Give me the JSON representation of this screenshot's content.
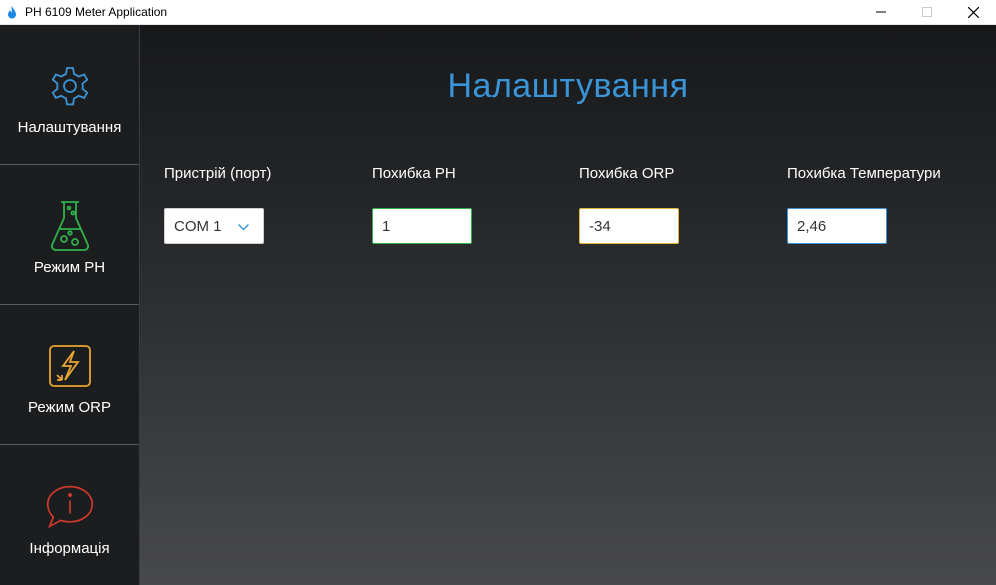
{
  "window": {
    "title": "PH 6109 Meter Application"
  },
  "sidebar": {
    "items": [
      {
        "label": "Налаштування",
        "icon": "gear-icon",
        "color": "#3a95d8"
      },
      {
        "label": "Режим PH",
        "icon": "flask-icon",
        "color": "#2eb34a"
      },
      {
        "label": "Режим ORP",
        "icon": "lightning-icon",
        "color": "#e8a531"
      },
      {
        "label": "Інформація",
        "icon": "info-bubble-icon",
        "color": "#d0392b"
      }
    ]
  },
  "main": {
    "title": "Налаштування",
    "fields": {
      "port": {
        "label": "Пристрій (порт)",
        "value": "COM 1"
      },
      "ph": {
        "label": "Похибка PH",
        "value": "1"
      },
      "orp": {
        "label": "Похибка ORP",
        "value": "-34"
      },
      "temp": {
        "label": "Похибка Температури",
        "value": "2,46"
      }
    }
  }
}
